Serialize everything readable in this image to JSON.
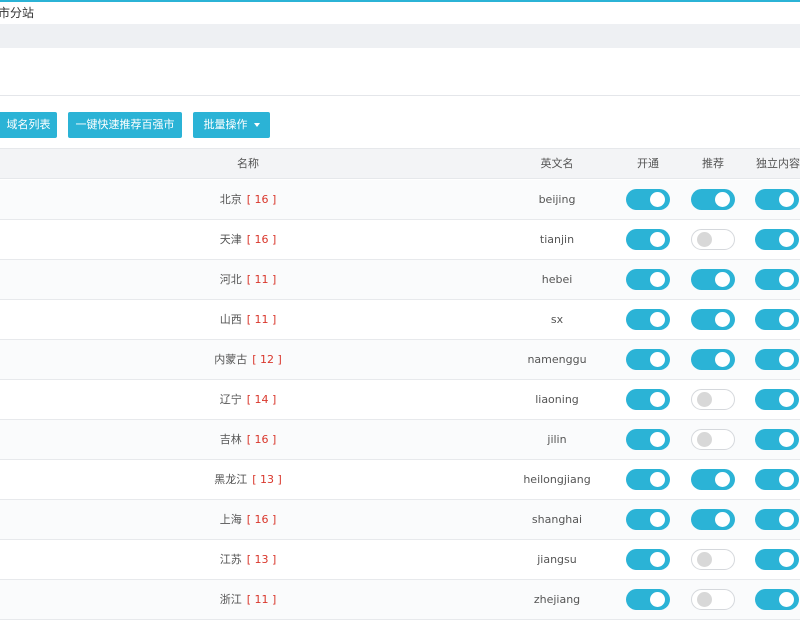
{
  "page": {
    "title": "市分站"
  },
  "toolbar": {
    "btn_list_label": "域名列表",
    "btn_quick_label": "一键快速推荐百强市",
    "btn_batch_label": "批量操作"
  },
  "table": {
    "headers": {
      "name": "名称",
      "english": "英文名",
      "open": "开通",
      "recommend": "推荐",
      "independent": "独立内容"
    },
    "rows": [
      {
        "name": "北京",
        "count": "[ 16 ]",
        "english": "beijing",
        "open": true,
        "recommend": true,
        "independent": true
      },
      {
        "name": "天津",
        "count": "[ 16 ]",
        "english": "tianjin",
        "open": true,
        "recommend": false,
        "independent": true
      },
      {
        "name": "河北",
        "count": "[ 11 ]",
        "english": "hebei",
        "open": true,
        "recommend": true,
        "independent": true
      },
      {
        "name": "山西",
        "count": "[ 11 ]",
        "english": "sx",
        "open": true,
        "recommend": true,
        "independent": true
      },
      {
        "name": "内蒙古",
        "count": "[ 12 ]",
        "english": "namenggu",
        "open": true,
        "recommend": true,
        "independent": true
      },
      {
        "name": "辽宁",
        "count": "[ 14 ]",
        "english": "liaoning",
        "open": true,
        "recommend": false,
        "independent": true
      },
      {
        "name": "吉林",
        "count": "[ 16 ]",
        "english": "jilin",
        "open": true,
        "recommend": false,
        "independent": true
      },
      {
        "name": "黑龙江",
        "count": "[ 13 ]",
        "english": "heilongjiang",
        "open": true,
        "recommend": true,
        "independent": true
      },
      {
        "name": "上海",
        "count": "[ 16 ]",
        "english": "shanghai",
        "open": true,
        "recommend": true,
        "independent": true
      },
      {
        "name": "江苏",
        "count": "[ 13 ]",
        "english": "jiangsu",
        "open": true,
        "recommend": false,
        "independent": true
      },
      {
        "name": "浙江",
        "count": "[ 11 ]",
        "english": "zhejiang",
        "open": true,
        "recommend": false,
        "independent": true
      }
    ]
  },
  "colors": {
    "accent": "#2bb3d6",
    "count": "#d9362b",
    "toggle_off": "#d8d8d8"
  }
}
